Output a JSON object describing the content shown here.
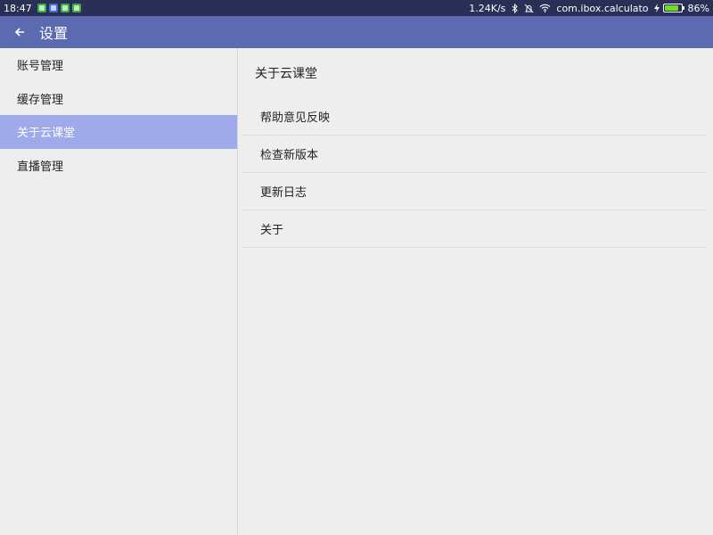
{
  "statusbar": {
    "time": "18:47",
    "notification_icons": [
      {
        "name": "notif-app-1-icon",
        "color": "#3cb043"
      },
      {
        "name": "notif-app-2-icon",
        "color": "#3f6fd8"
      },
      {
        "name": "notif-app-3-icon",
        "color": "#3cb043"
      },
      {
        "name": "notif-app-4-icon",
        "color": "#3cb043"
      }
    ],
    "network_speed": "1.24K/s",
    "app_text": "com.ibox.calculato",
    "battery_percent": "86%",
    "battery_level": 0.86,
    "battery_color": "#6fdc2a"
  },
  "appbar": {
    "back_icon": "arrow-left-icon",
    "title": "设置",
    "color": "#5c6bb0"
  },
  "sidenav": {
    "items": [
      {
        "label": "账号管理",
        "active": false
      },
      {
        "label": "缓存管理",
        "active": false
      },
      {
        "label": "关于云课堂",
        "active": true
      },
      {
        "label": "直播管理",
        "active": false
      }
    ],
    "active_color": "#9eaaea"
  },
  "content": {
    "title": "关于云课堂",
    "items": [
      {
        "label": "帮助意见反映"
      },
      {
        "label": "检查新版本"
      },
      {
        "label": "更新日志"
      },
      {
        "label": "关于"
      }
    ]
  }
}
